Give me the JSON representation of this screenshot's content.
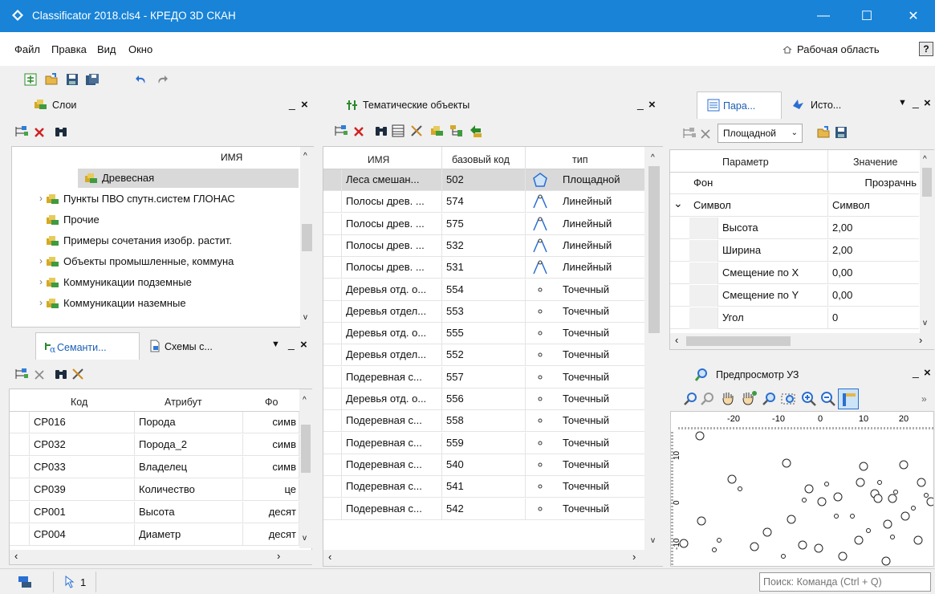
{
  "window": {
    "title": "Classificator 2018.cls4 - КРЕДО 3D СКАН",
    "minimize": "—",
    "maximize": "☐",
    "close": "✕"
  },
  "menu": {
    "items": [
      "Файл",
      "Правка",
      "Вид",
      "Окно"
    ],
    "workspace": "Рабочая область",
    "help": "?"
  },
  "layers": {
    "title": "Слои",
    "column": "ИМЯ",
    "items": [
      {
        "label": "Древесная",
        "selected": true,
        "expandable": false
      },
      {
        "label": "Пункты ПВО спутн.систем ГЛОНАС",
        "expandable": true
      },
      {
        "label": "Прочие",
        "expandable": false
      },
      {
        "label": "Примеры сочетания изобр. растит.",
        "expandable": false
      },
      {
        "label": "Объекты промышленные, коммуна",
        "expandable": true
      },
      {
        "label": "Коммуникации подземные",
        "expandable": true
      },
      {
        "label": "Коммуникации наземные",
        "expandable": true
      }
    ]
  },
  "semantics": {
    "tab1": "Семанти...",
    "tab2": "Схемы с...",
    "columns": [
      "Код",
      "Атрибут",
      "Фо"
    ],
    "rows": [
      [
        "CP016",
        "Порода",
        "симв"
      ],
      [
        "CP032",
        "Порода_2",
        "симв"
      ],
      [
        "CP033",
        "Владелец",
        "симв"
      ],
      [
        "CP039",
        "Количество",
        "це"
      ],
      [
        "CP001",
        "Высота",
        "десят"
      ],
      [
        "CP004",
        "Диаметр",
        "десят"
      ]
    ]
  },
  "thematic": {
    "title": "Тематические объекты",
    "columns": [
      "ИМЯ",
      "базовый код",
      "тип"
    ],
    "rows": [
      {
        "name": "Леса смешан...",
        "code": "502",
        "type": "Площадной",
        "icon": "polygon",
        "selected": true
      },
      {
        "name": "Полосы древ. ...",
        "code": "574",
        "type": "Линейный",
        "icon": "line"
      },
      {
        "name": "Полосы древ. ...",
        "code": "575",
        "type": "Линейный",
        "icon": "line"
      },
      {
        "name": "Полосы древ. ...",
        "code": "532",
        "type": "Линейный",
        "icon": "line"
      },
      {
        "name": "Полосы древ. ...",
        "code": "531",
        "type": "Линейный",
        "icon": "line"
      },
      {
        "name": "Деревья отд. о...",
        "code": "554",
        "type": "Точечный",
        "icon": "point"
      },
      {
        "name": "Деревья отдел...",
        "code": "553",
        "type": "Точечный",
        "icon": "point"
      },
      {
        "name": "Деревья отд. о...",
        "code": "555",
        "type": "Точечный",
        "icon": "point"
      },
      {
        "name": "Деревья отдел...",
        "code": "552",
        "type": "Точечный",
        "icon": "point"
      },
      {
        "name": "Подеревная с...",
        "code": "557",
        "type": "Точечный",
        "icon": "point"
      },
      {
        "name": "Деревья отд. о...",
        "code": "556",
        "type": "Точечный",
        "icon": "point"
      },
      {
        "name": "Подеревная с...",
        "code": "558",
        "type": "Точечный",
        "icon": "point"
      },
      {
        "name": "Подеревная с...",
        "code": "559",
        "type": "Точечный",
        "icon": "point"
      },
      {
        "name": "Подеревная с...",
        "code": "540",
        "type": "Точечный",
        "icon": "point"
      },
      {
        "name": "Подеревная с...",
        "code": "541",
        "type": "Точечный",
        "icon": "point"
      },
      {
        "name": "Подеревная с...",
        "code": "542",
        "type": "Точечный",
        "icon": "point"
      }
    ]
  },
  "params": {
    "tab1": "Пара...",
    "tab2": "Исто...",
    "type_select": "Площадной",
    "columns": [
      "Параметр",
      "Значение"
    ],
    "rows": [
      {
        "name": "Фон",
        "value": "Прозрачнь",
        "indent": 0,
        "expand": ""
      },
      {
        "name": "Символ",
        "value": "Символ",
        "indent": 0,
        "expand": "⌄"
      },
      {
        "name": "Высота",
        "value": "2,00",
        "indent": 1,
        "expand": ""
      },
      {
        "name": "Ширина",
        "value": "2,00",
        "indent": 1,
        "expand": ""
      },
      {
        "name": "Смещение по X",
        "value": "0,00",
        "indent": 1,
        "expand": ""
      },
      {
        "name": "Смещение по Y",
        "value": "0,00",
        "indent": 1,
        "expand": ""
      },
      {
        "name": "Угол",
        "value": "0",
        "indent": 1,
        "expand": ""
      }
    ]
  },
  "preview": {
    "title": "Предпросмотр УЗ",
    "ruler_top": [
      "-20",
      "-10",
      "0",
      "10",
      "20"
    ],
    "ruler_left": [
      "10",
      "0",
      "-10"
    ],
    "more": "»"
  },
  "status": {
    "selection_count": "1",
    "search_placeholder": "Поиск: Команда (Ctrl + Q)"
  }
}
